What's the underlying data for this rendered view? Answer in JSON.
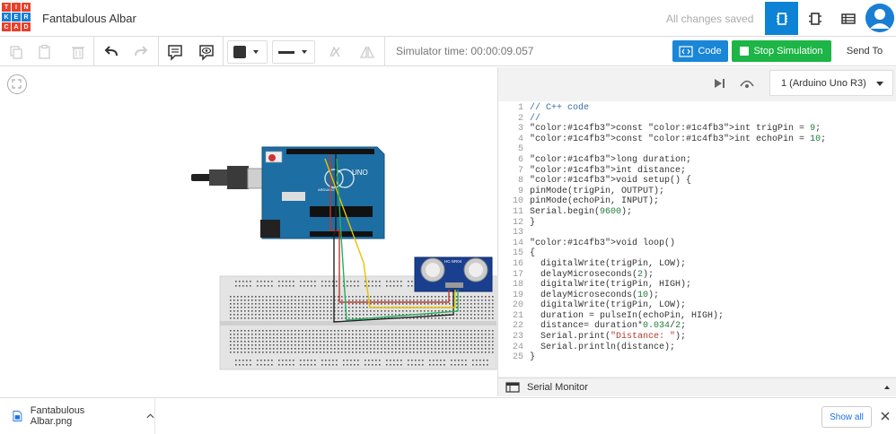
{
  "header": {
    "logo_letters": [
      "T",
      "I",
      "N",
      "K",
      "E",
      "R",
      "C",
      "A",
      "D"
    ],
    "title": "Fantabulous Albar",
    "save_status": "All changes saved",
    "views": [
      "circuit-view-icon",
      "schematic-view-icon",
      "component-list-icon"
    ],
    "accent": "#0e82d4"
  },
  "toolbar": {
    "simulator_time": "Simulator time: 00:00:09.057",
    "code_label": "Code",
    "stop_label": "Stop Simulation",
    "send_label": "Send To"
  },
  "code_panel": {
    "device": "1 (Arduino Uno R3)",
    "serial_label": "Serial Monitor",
    "lines": [
      "// C++ code",
      "//",
      "const int trigPin = 9;",
      "const int echoPin = 10;",
      "",
      "long duration;",
      "int distance;",
      "void setup() {",
      "pinMode(trigPin, OUTPUT);",
      "pinMode(echoPin, INPUT);",
      "Serial.begin(9600);",
      "}",
      "",
      "void loop()",
      "{",
      "  digitalWrite(trigPin, LOW);",
      "  delayMicroseconds(2);",
      "  digitalWrite(trigPin, HIGH);",
      "  delayMicroseconds(10);",
      "  digitalWrite(trigPin, LOW);",
      "  duration = pulseIn(echoPin, HIGH);",
      "  distance= duration*0.034/2;",
      "  Serial.print(\"Distance: \");",
      "  Serial.println(distance);",
      "}"
    ]
  },
  "circuit": {
    "arduino_label": "UNO",
    "arduino_brand": "ARDUINO",
    "sensor_label": "HC-SR04"
  },
  "downloads": {
    "file_name": "Fantabulous Albar.png",
    "show_all": "Show all"
  }
}
